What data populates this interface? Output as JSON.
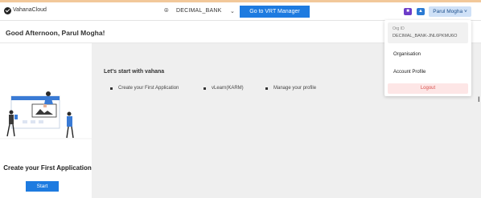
{
  "header": {
    "brand": "VahanaCloud",
    "workspace": "DECIMAL_BANK",
    "vrt_button": "Go to VRT Manager",
    "user_name": "Parul Mogha"
  },
  "greeting": "Good Afternoon, Parul Mogha!",
  "left_panel": {
    "title": "Create your First Application",
    "start_button": "Start"
  },
  "main": {
    "title": "Let's start with vahana",
    "items": [
      {
        "label": "Create your First Application"
      },
      {
        "label": "vLearn(KARM)"
      },
      {
        "label": "Manage your profile"
      }
    ]
  },
  "user_menu": {
    "org_id_label": "Org ID",
    "org_id_value": "DECIMAL_BANK-JNL6PKMU6O",
    "items": [
      {
        "label": "Organisation"
      },
      {
        "label": "Account Profile"
      }
    ],
    "logout": "Logout"
  },
  "colors": {
    "primary": "#1e7be0",
    "logout_bg": "#fde6e6",
    "logout_text": "#d9534f"
  }
}
